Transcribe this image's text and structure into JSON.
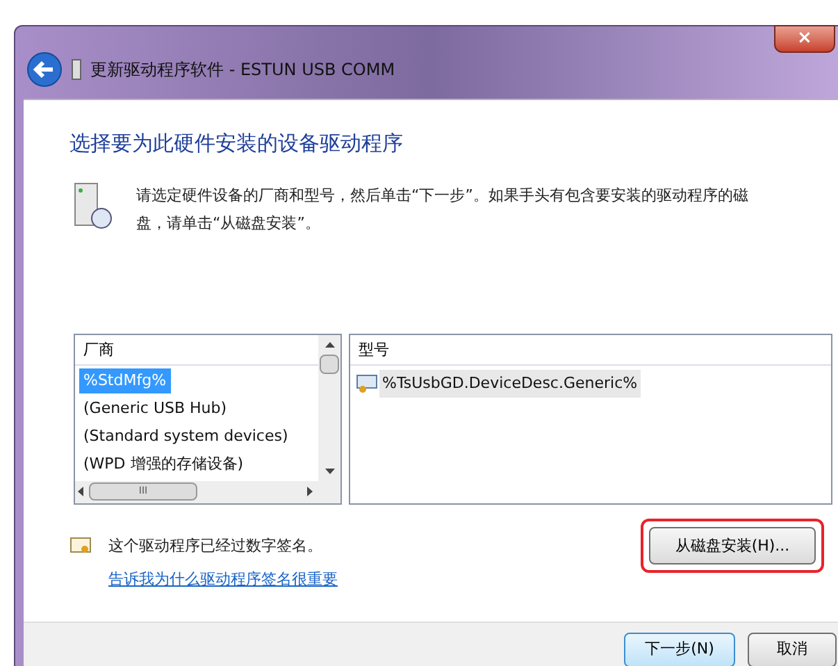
{
  "window": {
    "title": "更新驱动程序软件 - ESTUN USB COMM",
    "close": "×"
  },
  "heading": "选择要为此硬件安装的设备驱动程序",
  "description": "请选定硬件设备的厂商和型号，然后单击“下一步”。如果手头有包含要安装的驱动程序的磁盘，请单击“从磁盘安装”。",
  "manufacturers": {
    "header": "厂商",
    "items": [
      {
        "label": "%StdMfg%",
        "selected": true
      },
      {
        "label": "(Generic USB Hub)",
        "selected": false
      },
      {
        "label": "(Standard system devices)",
        "selected": false
      },
      {
        "label": "(WPD 增强的存储设备)",
        "selected": false
      }
    ],
    "hscroll_grip": "III"
  },
  "models": {
    "header": "型号",
    "items": [
      {
        "label": "%TsUsbGD.DeviceDesc.Generic%",
        "selected": true
      }
    ]
  },
  "signature_note": "这个驱动程序已经过数字签名。",
  "signature_link": "告诉我为什么驱动程序签名很重要",
  "have_disk_button": {
    "label": "从磁盘安装(H)...",
    "highlighted": true
  },
  "buttons": [
    {
      "label": "下一步(N)",
      "default": true
    },
    {
      "label": "取消",
      "default": false
    }
  ]
}
